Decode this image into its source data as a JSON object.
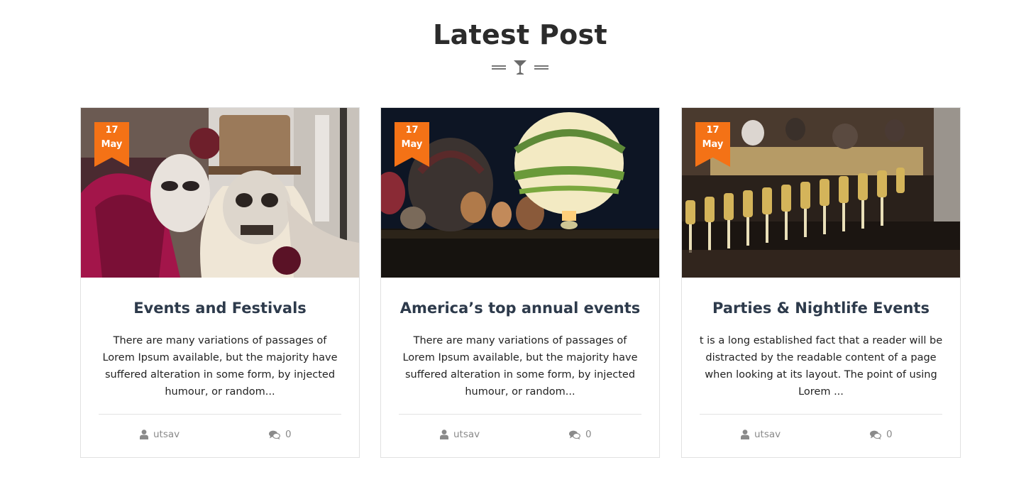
{
  "section": {
    "title": "Latest Post",
    "divider_icon": "cocktail-glass-icon"
  },
  "colors": {
    "accent": "#f47216",
    "title_text": "#2d3a4b",
    "meta_text": "#8a8a8a"
  },
  "posts": [
    {
      "day": "17",
      "month": "May",
      "image": "carnival-masks-photo",
      "title": "Events and Festivals",
      "excerpt": "There are many variations of passages of Lorem Ipsum available, but the majority have suffered alteration in some form, by injected humour, or random...",
      "author": "utsav",
      "comments": "0"
    },
    {
      "day": "17",
      "month": "May",
      "image": "hot-air-balloons-night-photo",
      "title": "America’s top annual events",
      "excerpt": "There are many variations of passages of Lorem Ipsum available, but the majority have suffered alteration in some form, by injected humour, or random...",
      "author": "utsav",
      "comments": "0"
    },
    {
      "day": "17",
      "month": "May",
      "image": "champagne-glasses-bar-photo",
      "title": "Parties & Nightlife Events",
      "excerpt": "t is a long established fact that a reader will be distracted by the readable content of a page when looking at its layout. The point of using Lorem ...",
      "author": "utsav",
      "comments": "0"
    }
  ]
}
